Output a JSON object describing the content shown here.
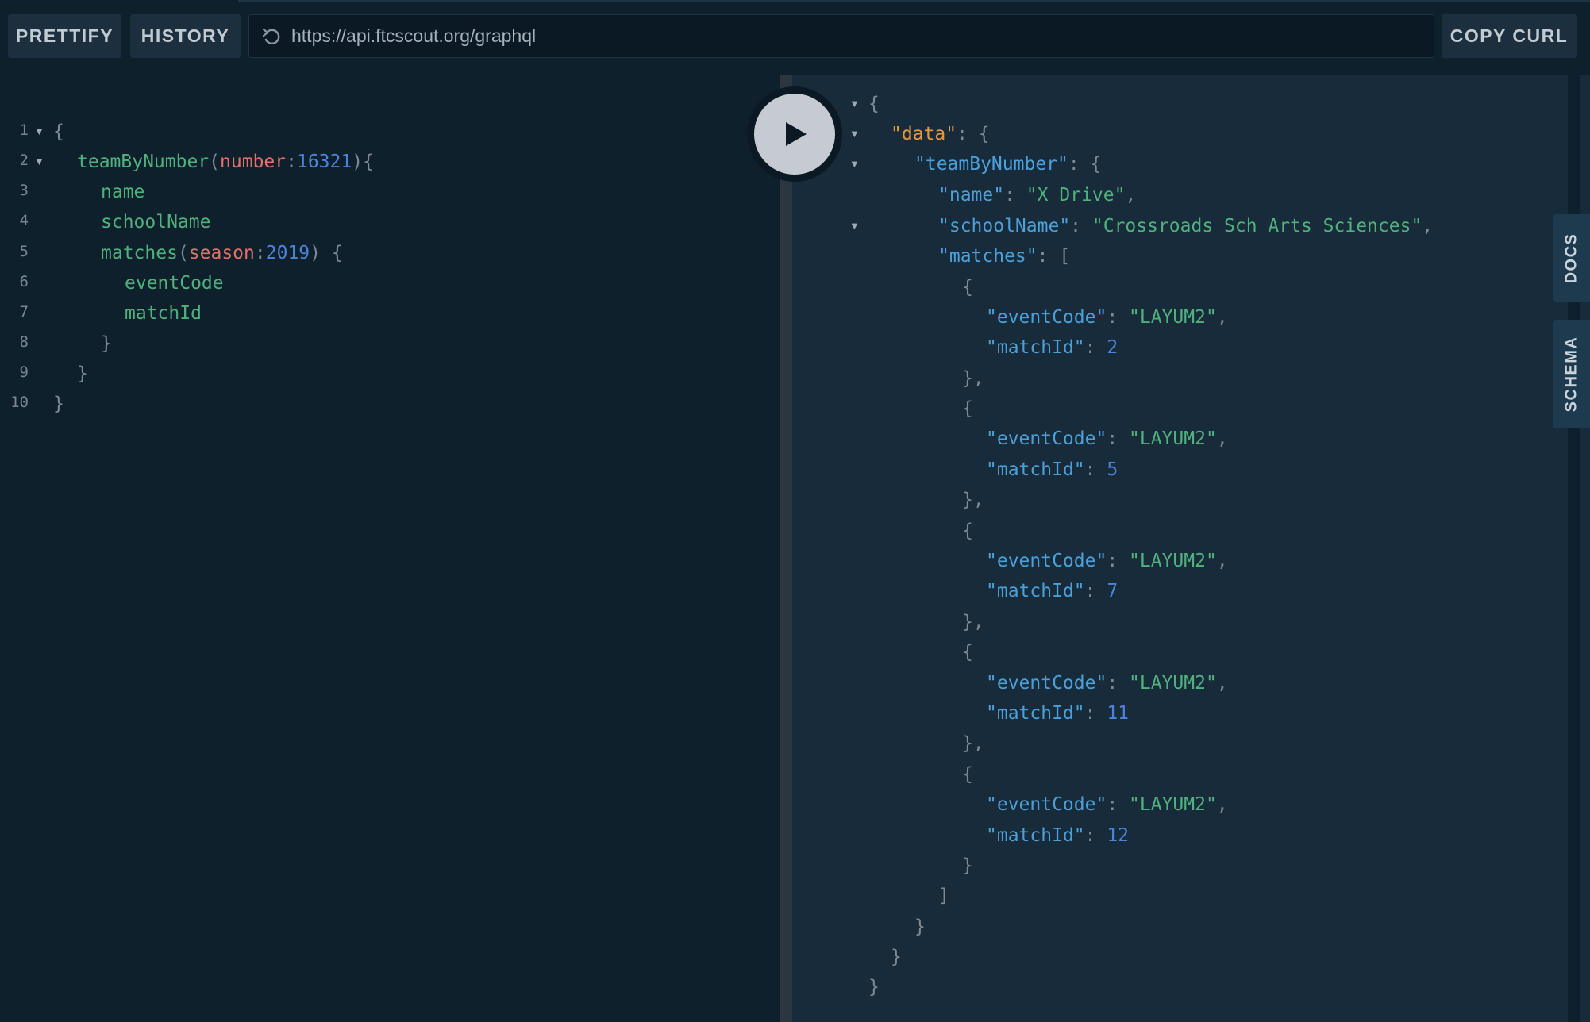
{
  "toolbar": {
    "prettify_label": "PRETTIFY",
    "history_label": "HISTORY",
    "url": "https://api.ftcscout.org/graphql",
    "copy_curl_label": "COPY CURL"
  },
  "side_tabs": {
    "docs_label": "DOCS",
    "schema_label": "SCHEMA"
  },
  "editor": {
    "line_numbers": [
      "1",
      "2",
      "3",
      "4",
      "5",
      "6",
      "7",
      "8",
      "9",
      "10"
    ],
    "q": {
      "open_brace": "{",
      "team_field": "teamByNumber",
      "paren_open": "(",
      "number_arg": "number",
      "colon": ":",
      "number_val": "16321",
      "paren_close_brace": "){",
      "name": "name",
      "school": "schoolName",
      "matches": "matches",
      "season_arg": "season",
      "season_val": "2019",
      "paren_close_sp_brace": ") {",
      "event_code": "eventCode",
      "match_id": "matchId",
      "close_brace": "}"
    }
  },
  "result": {
    "k_data": "\"data\"",
    "k_team": "\"teamByNumber\"",
    "k_name": "\"name\"",
    "v_name": "\"X Drive\"",
    "k_school": "\"schoolName\"",
    "v_school": "\"Crossroads Sch Arts Sciences\"",
    "k_matches": "\"matches\"",
    "k_event": "\"eventCode\"",
    "k_match_id": "\"matchId\"",
    "v_event_1": "\"LAYUM2\"",
    "v_event_2": "\"LAYUM2\"",
    "v_event_3": "\"LAYUM2\"",
    "v_event_4": "\"LAYUM2\"",
    "v_event_5": "\"LAYUM2\"",
    "v_match_1": "2",
    "v_match_2": "5",
    "v_match_3": "7",
    "v_match_4": "11",
    "v_match_5": "12",
    "p_open_brace": "{",
    "p_colon_brace": ": {",
    "p_colon_bracket": ": [",
    "p_colon": ": ",
    "p_comma": ",",
    "p_close_brace_comma": "},",
    "p_close_brace": "}",
    "p_close_bracket": "]"
  }
}
